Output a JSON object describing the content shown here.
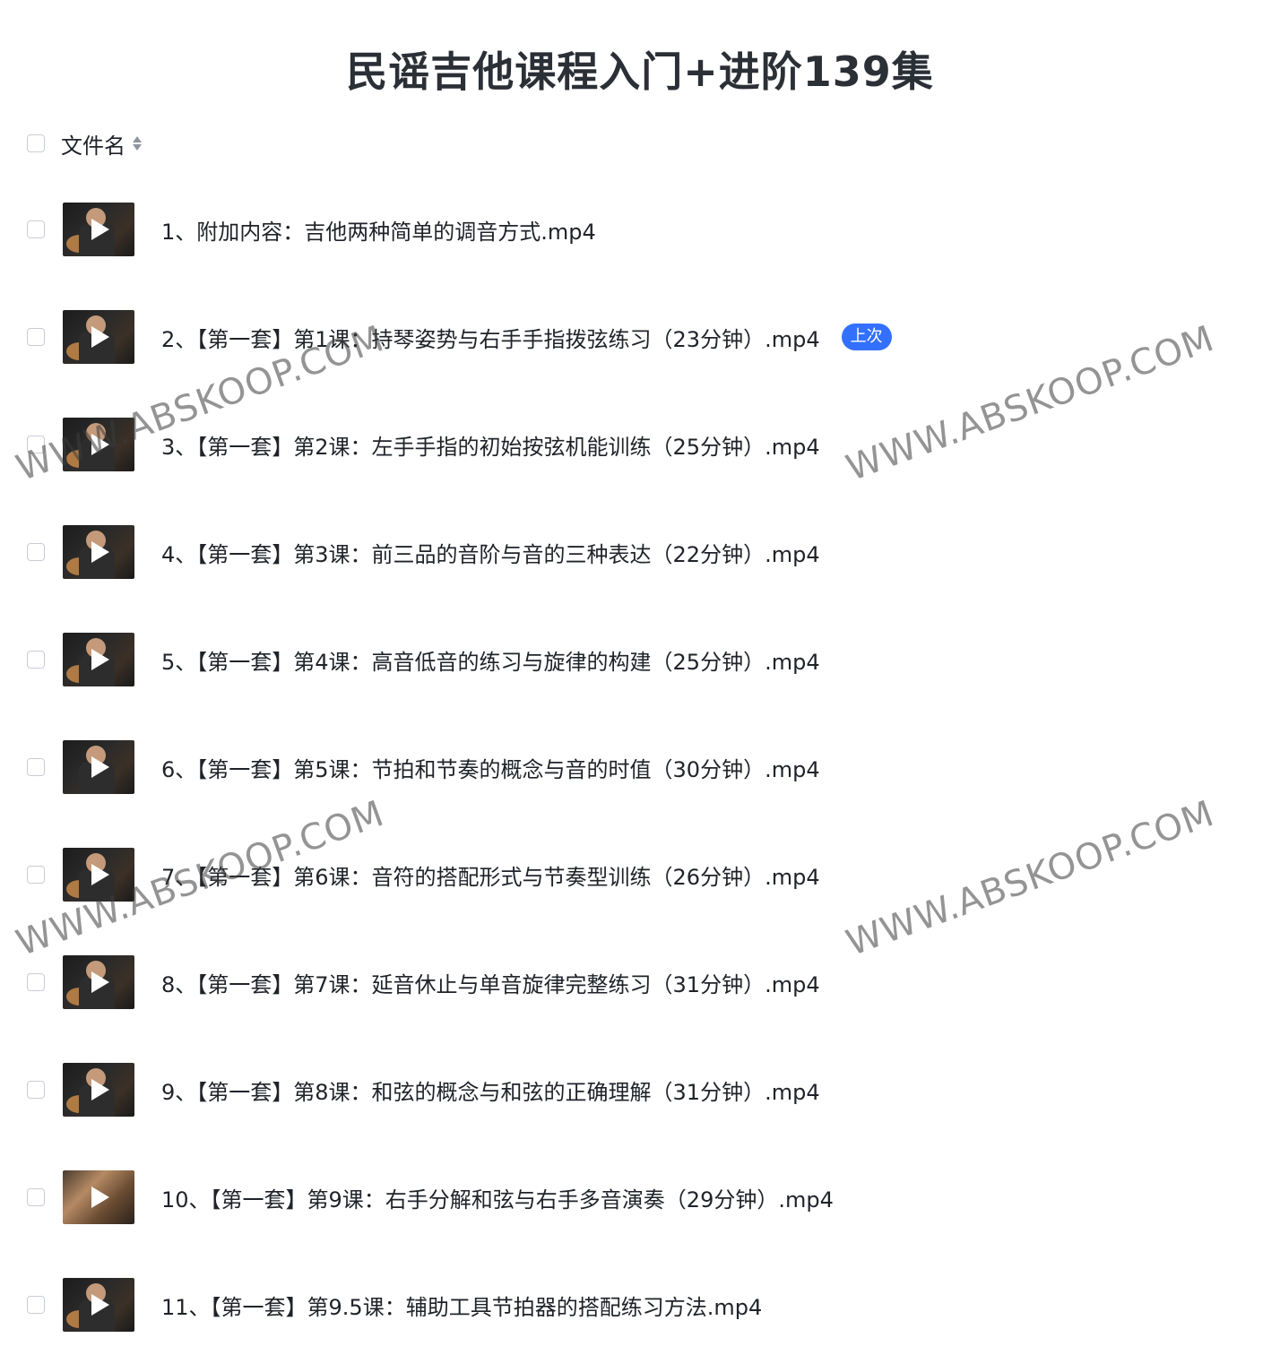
{
  "title": "民谣吉他课程入门+进阶139集",
  "header": {
    "column_label": "文件名"
  },
  "files": [
    {
      "name": "1、附加内容：吉他两种简单的调音方式.mp4"
    },
    {
      "name": "2、【第一套】第1课：持琴姿势与右手手指拨弦练习（23分钟）.mp4",
      "badge": "上次"
    },
    {
      "name": "3、【第一套】第2课：左手手指的初始按弦机能训练（25分钟）.mp4"
    },
    {
      "name": "4、【第一套】第3课：前三品的音阶与音的三种表达（22分钟）.mp4"
    },
    {
      "name": "5、【第一套】第4课：高音低音的练习与旋律的构建（25分钟）.mp4"
    },
    {
      "name": "6、【第一套】第5课：节拍和节奏的概念与音的时值（30分钟）.mp4"
    },
    {
      "name": "7、【第一套】第6课：音符的搭配形式与节奏型训练（26分钟）.mp4"
    },
    {
      "name": "8、【第一套】第7课：延音休止与单音旋律完整练习（31分钟）.mp4"
    },
    {
      "name": "9、【第一套】第8课：和弦的概念与和弦的正确理解（31分钟）.mp4"
    },
    {
      "name": "10、【第一套】第9课：右手分解和弦与右手多音演奏（29分钟）.mp4"
    },
    {
      "name": "11、【第一套】第9.5课：辅助工具节拍器的搭配练习方法.mp4"
    }
  ],
  "watermark": "WWW.ABSKOOP.COM",
  "colors": {
    "badge": "#3370ff",
    "text": "#1f2329",
    "checkbox_border": "#c9cdd4"
  }
}
